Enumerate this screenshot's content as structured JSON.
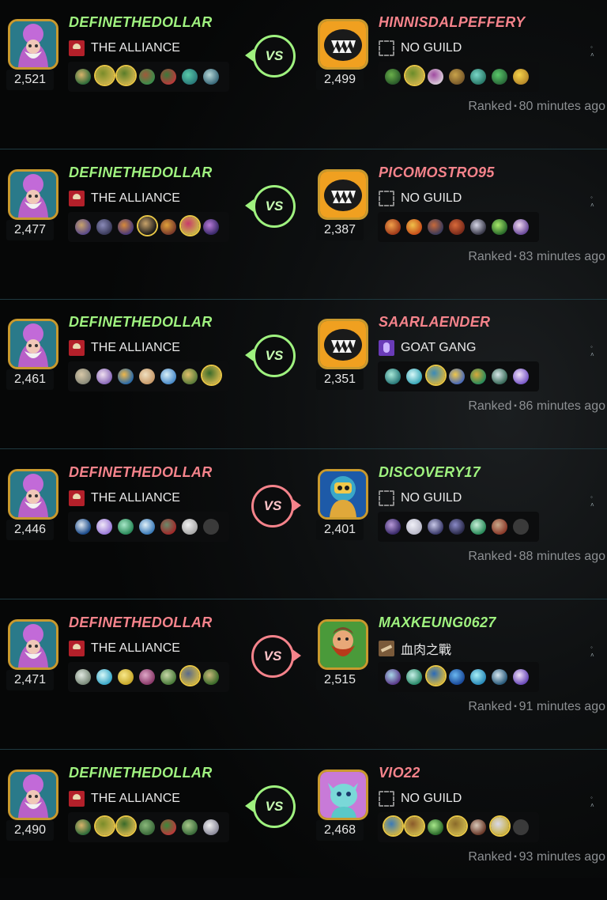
{
  "vs_label": "VS",
  "battles": [
    {
      "left": {
        "name": "DEFINETHEDOLLAR",
        "guild": "THE ALLIANCE",
        "guild_icon": "alliance",
        "rating": "2,521",
        "result": "win",
        "avatar": "wizard",
        "cards": [
          [
            "#2e6b3a",
            "#d9b36a"
          ],
          [
            "#c9b24a",
            "#7a8c2a",
            1
          ],
          [
            "#c9b24a",
            "#5a7d2a",
            1
          ],
          [
            "#3b8c4a",
            "#a05a3a"
          ],
          [
            "#b83a3a",
            "#3a7a3a"
          ],
          [
            "#2a7a7a",
            "#59c9a8"
          ],
          [
            "#3a6a7a",
            "#b8d8d8"
          ]
        ]
      },
      "right": {
        "name": "HINNISDALPEFFERY",
        "guild": "NO GUILD",
        "guild_icon": "none",
        "rating": "2,499",
        "result": "lose",
        "avatar": "monster",
        "cards": [
          [
            "#2a5a2a",
            "#6ab04a"
          ],
          [
            "#c9b24a",
            "#6a8c2a",
            1
          ],
          [
            "#d8c8d8",
            "#a04aa0"
          ],
          [
            "#7a5a2a",
            "#c9a34a"
          ],
          [
            "#2a7a6a",
            "#7ad8c8"
          ],
          [
            "#2a6a3a",
            "#5ac86a"
          ],
          [
            "#b88a2a",
            "#f5d24a"
          ]
        ]
      },
      "winner_side": "left",
      "mode": "Ranked",
      "time": "80 minutes ago"
    },
    {
      "left": {
        "name": "DEFINETHEDOLLAR",
        "guild": "THE ALLIANCE",
        "guild_icon": "alliance",
        "rating": "2,477",
        "result": "win",
        "avatar": "wizard",
        "cards": [
          [
            "#5a4a8a",
            "#c9a36a"
          ],
          [
            "#3a3a5a",
            "#8a8ab8"
          ],
          [
            "#4a3a7a",
            "#d88a3a"
          ],
          [
            "#1a1a1a",
            "#c9a36a",
            1
          ],
          [
            "#7a3a2a",
            "#e0a03a"
          ],
          [
            "#c9b24a",
            "#c83a6a",
            1
          ],
          [
            "#3a2a6a",
            "#b87ad8"
          ]
        ]
      },
      "right": {
        "name": "PICOMOSTRO95",
        "guild": "NO GUILD",
        "guild_icon": "none",
        "rating": "2,387",
        "result": "lose",
        "avatar": "monster",
        "cards": [
          [
            "#a03a1a",
            "#f0a04a"
          ],
          [
            "#c8501a",
            "#f0c04a"
          ],
          [
            "#3a3a5a",
            "#c86a3a"
          ],
          [
            "#7a2a1a",
            "#d86a3a"
          ],
          [
            "#3a3a4a",
            "#d8d8e8"
          ],
          [
            "#2a6a2a",
            "#a8e86a"
          ],
          [
            "#6a4a9a",
            "#f0d8f0"
          ]
        ]
      },
      "winner_side": "left",
      "mode": "Ranked",
      "time": "83 minutes ago"
    },
    {
      "left": {
        "name": "DEFINETHEDOLLAR",
        "guild": "THE ALLIANCE",
        "guild_icon": "alliance",
        "rating": "2,461",
        "result": "win",
        "avatar": "wizard",
        "cards": [
          [
            "#8a8a7a",
            "#d8c8a8"
          ],
          [
            "#8a6ab8",
            "#f0e0f0"
          ],
          [
            "#2a6aa8",
            "#f0b84a"
          ],
          [
            "#c89a6a",
            "#f0e0c0"
          ],
          [
            "#4a8ac8",
            "#d8f0f8"
          ],
          [
            "#5a7a3a",
            "#e0c06a"
          ],
          [
            "#c9b24a",
            "#3a6a2a",
            1
          ]
        ]
      },
      "right": {
        "name": "SAARLAENDER",
        "guild": "GOAT GANG",
        "guild_icon": "goat",
        "rating": "2,351",
        "result": "lose",
        "avatar": "monster",
        "cards": [
          [
            "#2a7a7a",
            "#a8e8d8"
          ],
          [
            "#3aa8b8",
            "#d8f8f8"
          ],
          [
            "#c9b24a",
            "#3a8ab8",
            1
          ],
          [
            "#4a6ab8",
            "#f0c84a"
          ],
          [
            "#2a8a5a",
            "#d8a83a"
          ],
          [
            "#3a6a5a",
            "#d8e8e8"
          ],
          [
            "#7a5ac8",
            "#f0e0f8"
          ]
        ]
      },
      "winner_side": "left",
      "mode": "Ranked",
      "time": "86 minutes ago"
    },
    {
      "left": {
        "name": "DEFINETHEDOLLAR",
        "guild": "THE ALLIANCE",
        "guild_icon": "alliance",
        "rating": "2,446",
        "result": "lose",
        "avatar": "wizard",
        "cards": [
          [
            "#1a4a8a",
            "#e0e8f0"
          ],
          [
            "#9a7ad8",
            "#f0e8f8"
          ],
          [
            "#2a8a5a",
            "#a8e8c8"
          ],
          [
            "#3a7ab8",
            "#e0f0f8"
          ],
          [
            "#a02a2a",
            "#6a8a6a"
          ],
          [
            "#a8a8a8",
            "#f0f0f0"
          ],
          [
            "#3a3a3a",
            "#3a3a3a",
            0,
            1
          ]
        ]
      },
      "right": {
        "name": "DISCOVERY17",
        "guild": "NO GUILD",
        "guild_icon": "none",
        "rating": "2,401",
        "result": "win",
        "avatar": "robot",
        "cards": [
          [
            "#3a2a6a",
            "#b89ad8"
          ],
          [
            "#b8b8c8",
            "#f0f0f8"
          ],
          [
            "#3a3a6a",
            "#c8c8e8"
          ],
          [
            "#2a2a4a",
            "#8a8ac8"
          ],
          [
            "#2a8a5a",
            "#c8f0d8"
          ],
          [
            "#8a3a2a",
            "#c8a88a"
          ],
          [
            "#3a3a3a",
            "#3a3a3a",
            0,
            1
          ]
        ]
      },
      "winner_side": "right",
      "mode": "Ranked",
      "time": "88 minutes ago"
    },
    {
      "left": {
        "name": "DEFINETHEDOLLAR",
        "guild": "THE ALLIANCE",
        "guild_icon": "alliance",
        "rating": "2,471",
        "result": "lose",
        "avatar": "wizard",
        "cards": [
          [
            "#7a8a7a",
            "#e0e8e0"
          ],
          [
            "#3aa8c8",
            "#d8f8f8"
          ],
          [
            "#c8a82a",
            "#f8e88a"
          ],
          [
            "#8a3a6a",
            "#e0a8c8"
          ],
          [
            "#4a7a3a",
            "#c8d8a8"
          ],
          [
            "#c9b24a",
            "#5a6a8a",
            1
          ],
          [
            "#3a6a2a",
            "#c8b87a"
          ]
        ]
      },
      "right": {
        "name": "MAXKEUNG0627",
        "guild": "血肉之戰",
        "guild_icon": "blood",
        "rating": "2,515",
        "result": "win",
        "avatar": "dwarf",
        "cards": [
          [
            "#5a3a8a",
            "#a8d8e8"
          ],
          [
            "#2a8a6a",
            "#c8f0e8"
          ],
          [
            "#c9b24a",
            "#2a6ab8",
            1
          ],
          [
            "#1a4a9a",
            "#6ab8f0"
          ],
          [
            "#2a8ab8",
            "#a8f0f8"
          ],
          [
            "#2a5a7a",
            "#d8e8f0"
          ],
          [
            "#6a4ab8",
            "#f0e0f8"
          ]
        ]
      },
      "winner_side": "right",
      "mode": "Ranked",
      "time": "91 minutes ago"
    },
    {
      "left": {
        "name": "DEFINETHEDOLLAR",
        "guild": "THE ALLIANCE",
        "guild_icon": "alliance",
        "rating": "2,490",
        "result": "win",
        "avatar": "wizard",
        "cards": [
          [
            "#2e6b3a",
            "#d9b36a"
          ],
          [
            "#c9b24a",
            "#7a8c2a",
            1
          ],
          [
            "#c9b24a",
            "#3a6a2a",
            1
          ],
          [
            "#3a6a3a",
            "#8ab87a"
          ],
          [
            "#b83a3a",
            "#3a8a3a"
          ],
          [
            "#3a6a3a",
            "#a8c88a"
          ],
          [
            "#8a8a9a",
            "#f0f0f0"
          ]
        ]
      },
      "right": {
        "name": "VIO22",
        "guild": "NO GUILD",
        "guild_icon": "none",
        "rating": "2,468",
        "result": "lose",
        "avatar": "dragon",
        "cards": [
          [
            "#c9b24a",
            "#3a7ab8",
            1
          ],
          [
            "#c9b24a",
            "#8a5a2a",
            1
          ],
          [
            "#2a6a2a",
            "#a8e88a"
          ],
          [
            "#c9b24a",
            "#8a6a2a",
            1
          ],
          [
            "#6a3a2a",
            "#d8c8b8"
          ],
          [
            "#c9b24a",
            "#d8d8e8",
            1
          ],
          [
            "#3a3a3a",
            "#3a3a3a",
            0,
            1
          ]
        ]
      },
      "winner_side": "left",
      "mode": "Ranked",
      "time": "93 minutes ago"
    }
  ]
}
